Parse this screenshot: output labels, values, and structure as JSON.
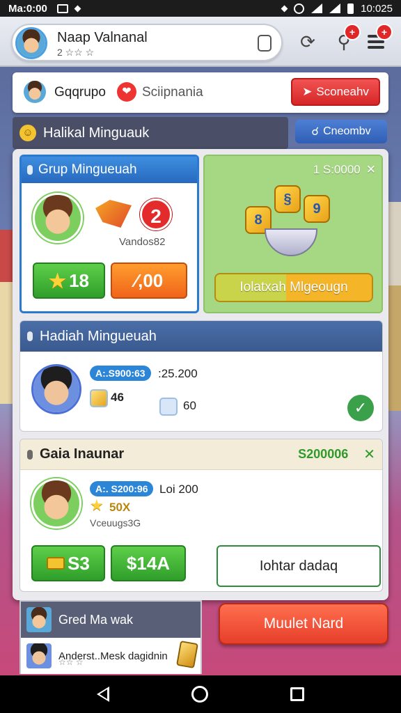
{
  "status_bar": {
    "time": "Ma:0:00",
    "clock": "10:025"
  },
  "header": {
    "player_name": "Naap Valnanal",
    "player_level": "2 ☆☆ ☆",
    "badge_notifications": "+",
    "badge_menu": "+"
  },
  "group_bar": {
    "label": "Gqqrupo",
    "sub_label": "Sciipnania",
    "action_button": "Sconeahv"
  },
  "strip": {
    "title": "Halikal Minguauk",
    "button": "Cneombv"
  },
  "card_group": {
    "title": "Grup Mingueuah",
    "number": "2",
    "sub_label": "Vandos82",
    "stars_value": "18",
    "orange_value": "⁄,00"
  },
  "card_reward": {
    "amount": "1 S:0000",
    "treasure_coins": [
      "8",
      "§",
      "9"
    ],
    "bar_label": "Iolatxah Mlgeougn"
  },
  "list_hadiah": {
    "title": "Hadiah Mingueuah",
    "tag": "A:.S900:63",
    "value": ":25.200",
    "count": "46",
    "coins": "60"
  },
  "list_gaia": {
    "title": "Gaia Inaunar",
    "amount": "S200006",
    "tag": "A:. S200:96",
    "value": "Loi 200",
    "stars": "50X",
    "sub_label": "Vceuugs3G",
    "green_value_1": "S3",
    "green_value_2": "$14A",
    "outline_button": "Iohtar dadaq"
  },
  "bottom_list": {
    "row1": "Gred Ma wak",
    "row2": "Anderst..Mesk dagidnin",
    "row2_stars": "☆☆ ☆"
  },
  "bottom_button": "Muulet Nard",
  "colors": {
    "accent_blue": "#2a7bd0",
    "accent_red": "#e02828",
    "accent_green": "#2f9e2a",
    "accent_orange": "#f0641a"
  }
}
